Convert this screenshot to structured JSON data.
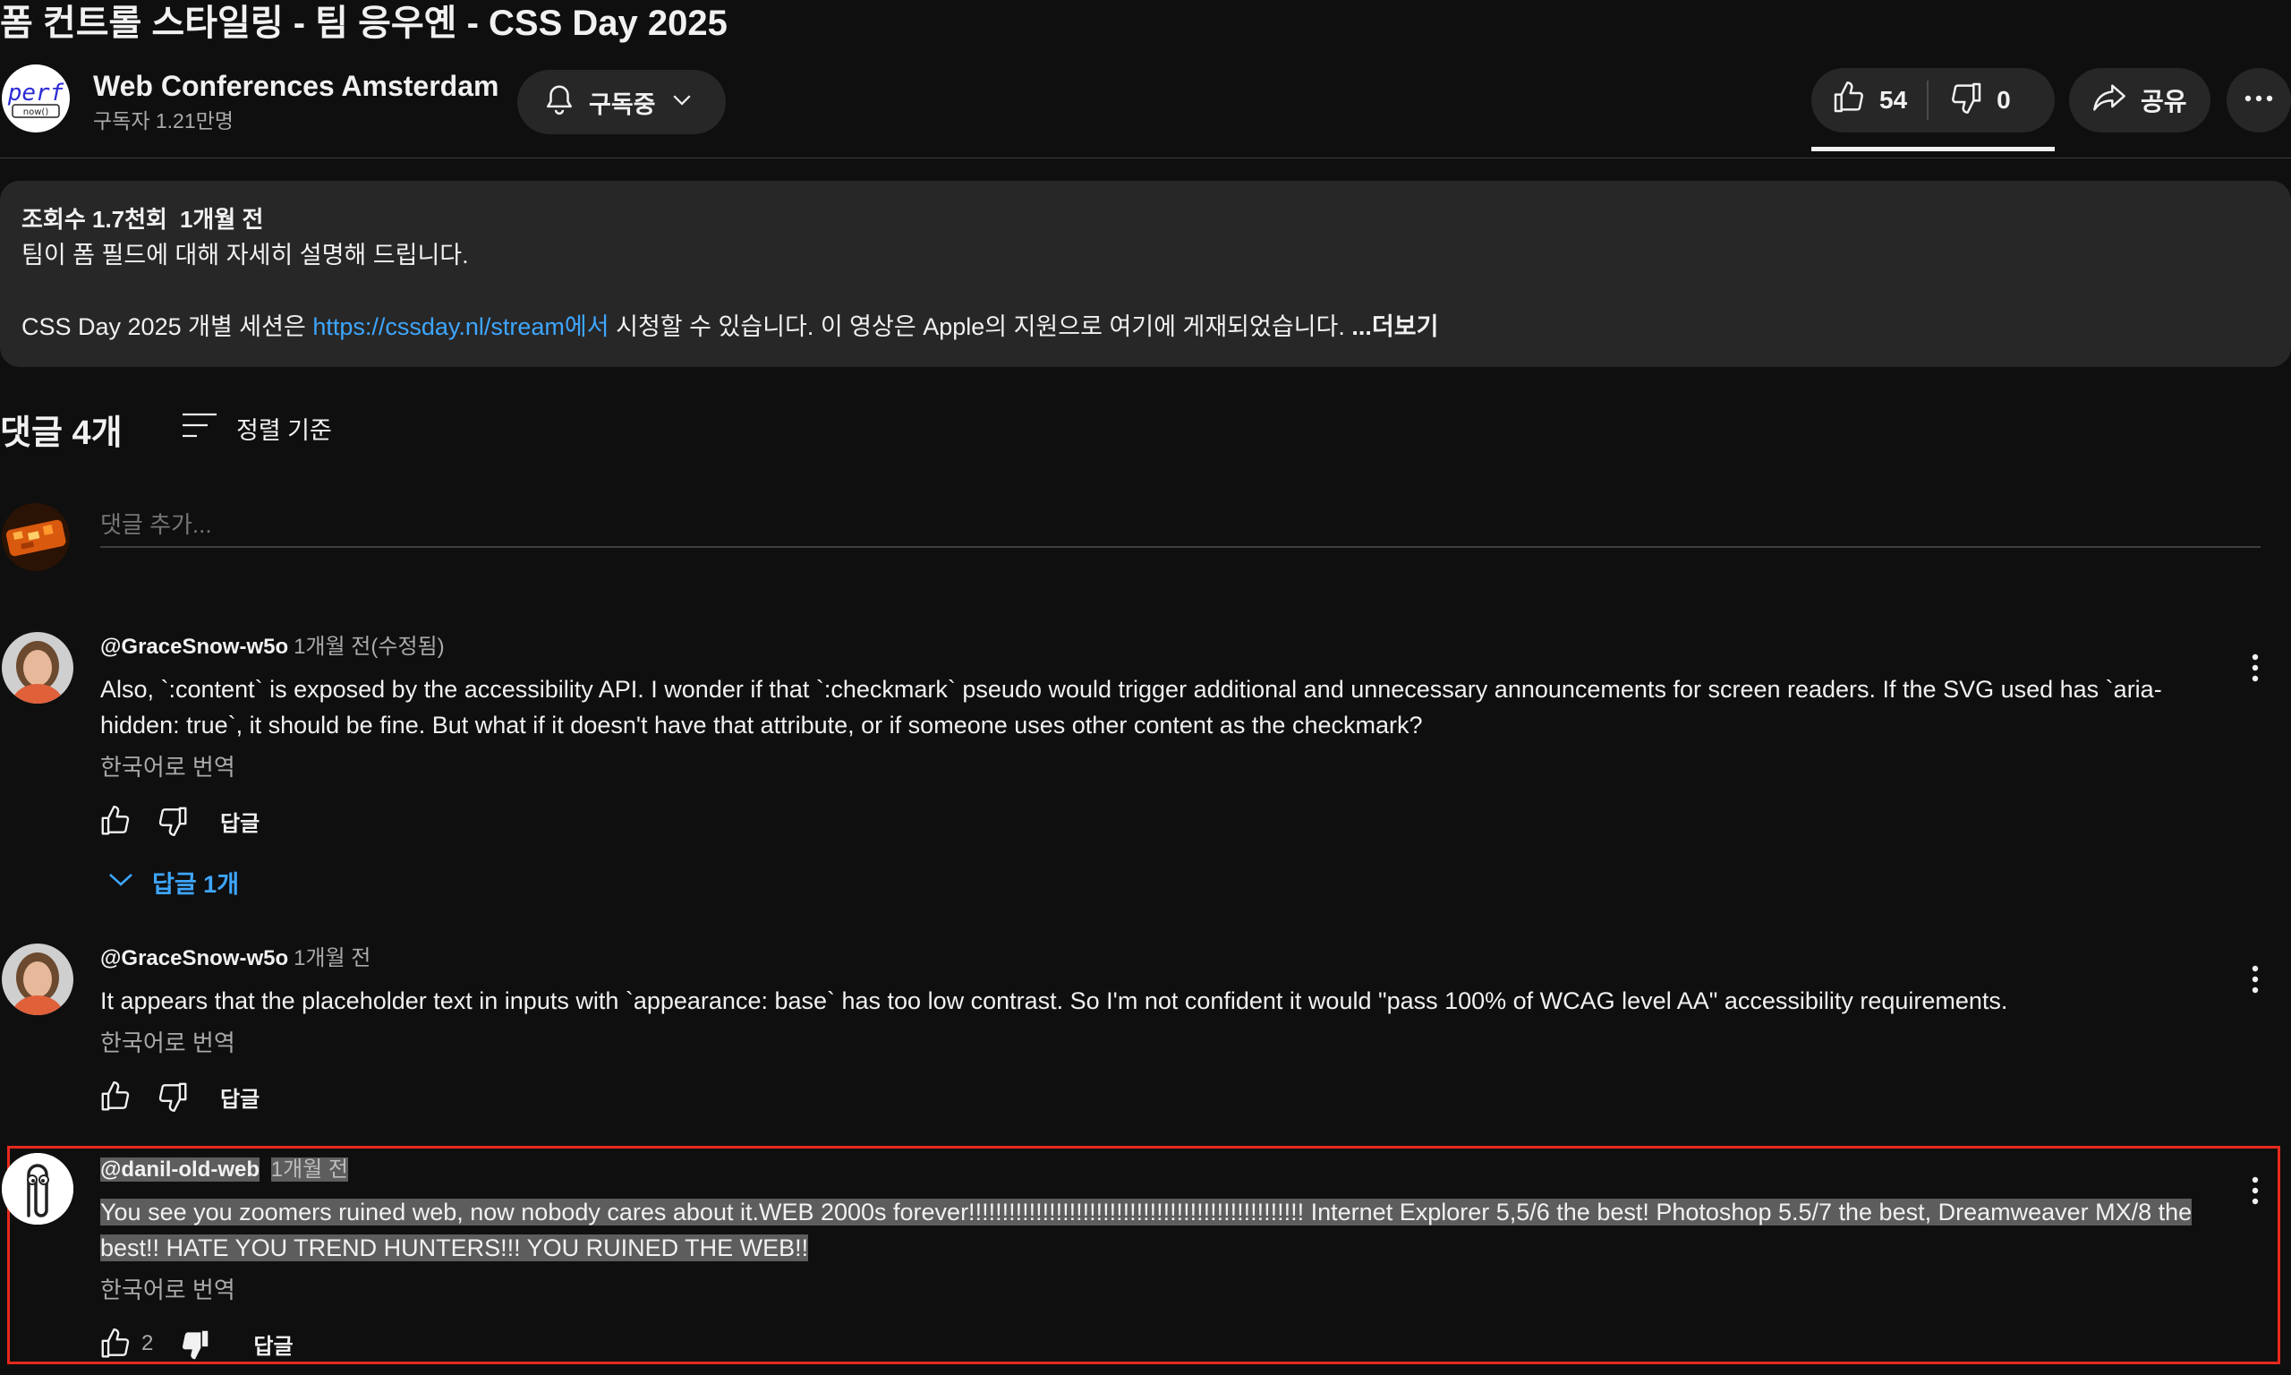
{
  "video": {
    "title": "폼 컨트롤 스타일링 - 팀 응우옌 - CSS Day 2025"
  },
  "channel": {
    "logo_text": "perf",
    "logo_subtext": "now()",
    "name": "Web Conferences Amsterdam",
    "subscribers": "구독자 1.21만명",
    "subscribe_label": "구독중"
  },
  "actions": {
    "likes": "54",
    "dislikes": "0",
    "share_label": "공유"
  },
  "description": {
    "views": "조회수 1.7천회",
    "age": "1개월 전",
    "line1": "팀이 폼 필드에 대해 자세히 설명해 드립니다.",
    "line2_prefix": "CSS Day 2025 개별 세션은 ",
    "link": "https://cssday.nl/stream에서",
    "line2_suffix": " 시청할 수 있습니다. 이 영상은 Apple의 지원으로 여기에 게재되었습니다.",
    "more": "...더보기"
  },
  "comments_header": {
    "count_label": "댓글 4개",
    "sort_label": "정렬 기준",
    "add_placeholder": "댓글 추가..."
  },
  "comments": [
    {
      "author": "@GraceSnow-w5o",
      "time": "1개월 전(수정됨)",
      "text": "Also, `:content` is exposed by the accessibility API. I wonder if that `:checkmark` pseudo would trigger additional and unnecessary announcements for screen readers. If the SVG used has `aria-hidden: true`, it should be fine. But what if it doesn't have that attribute, or if someone uses other content as the checkmark?",
      "translate": "한국어로 번역",
      "reply_label": "답글",
      "replies_label": "답글 1개"
    },
    {
      "author": "@GraceSnow-w5o",
      "time": "1개월 전",
      "text": "It appears that the placeholder text in inputs with `appearance: base` has too low contrast. So I'm not confident it would \"pass 100% of WCAG level AA\" accessibility requirements.",
      "translate": "한국어로 번역",
      "reply_label": "답글"
    },
    {
      "author": "@danil-old-web",
      "time": "1개월 전",
      "text_line1": "You see you zoomers ruined web, now nobody cares about it.WEB 2000s forever!!!!!!!!!!!!!!!!!!!!!!!!!!!!!!!!!!!!!!!!!!!!!!!!!! Internet Explorer 5,5/6 the best! Photoshop 5.5/7 the best, Dreamweaver MX/8 the",
      "text_line2": "best!! HATE YOU TREND HUNTERS!!! YOU RUINED THE WEB!!",
      "translate": "한국어로 번역",
      "like_count": "2",
      "reply_label": "답글"
    }
  ],
  "colors": {
    "background": "#0f0f0f",
    "surface": "#272727",
    "link": "#3ea6ff",
    "highlight_box": "#e8291c"
  }
}
